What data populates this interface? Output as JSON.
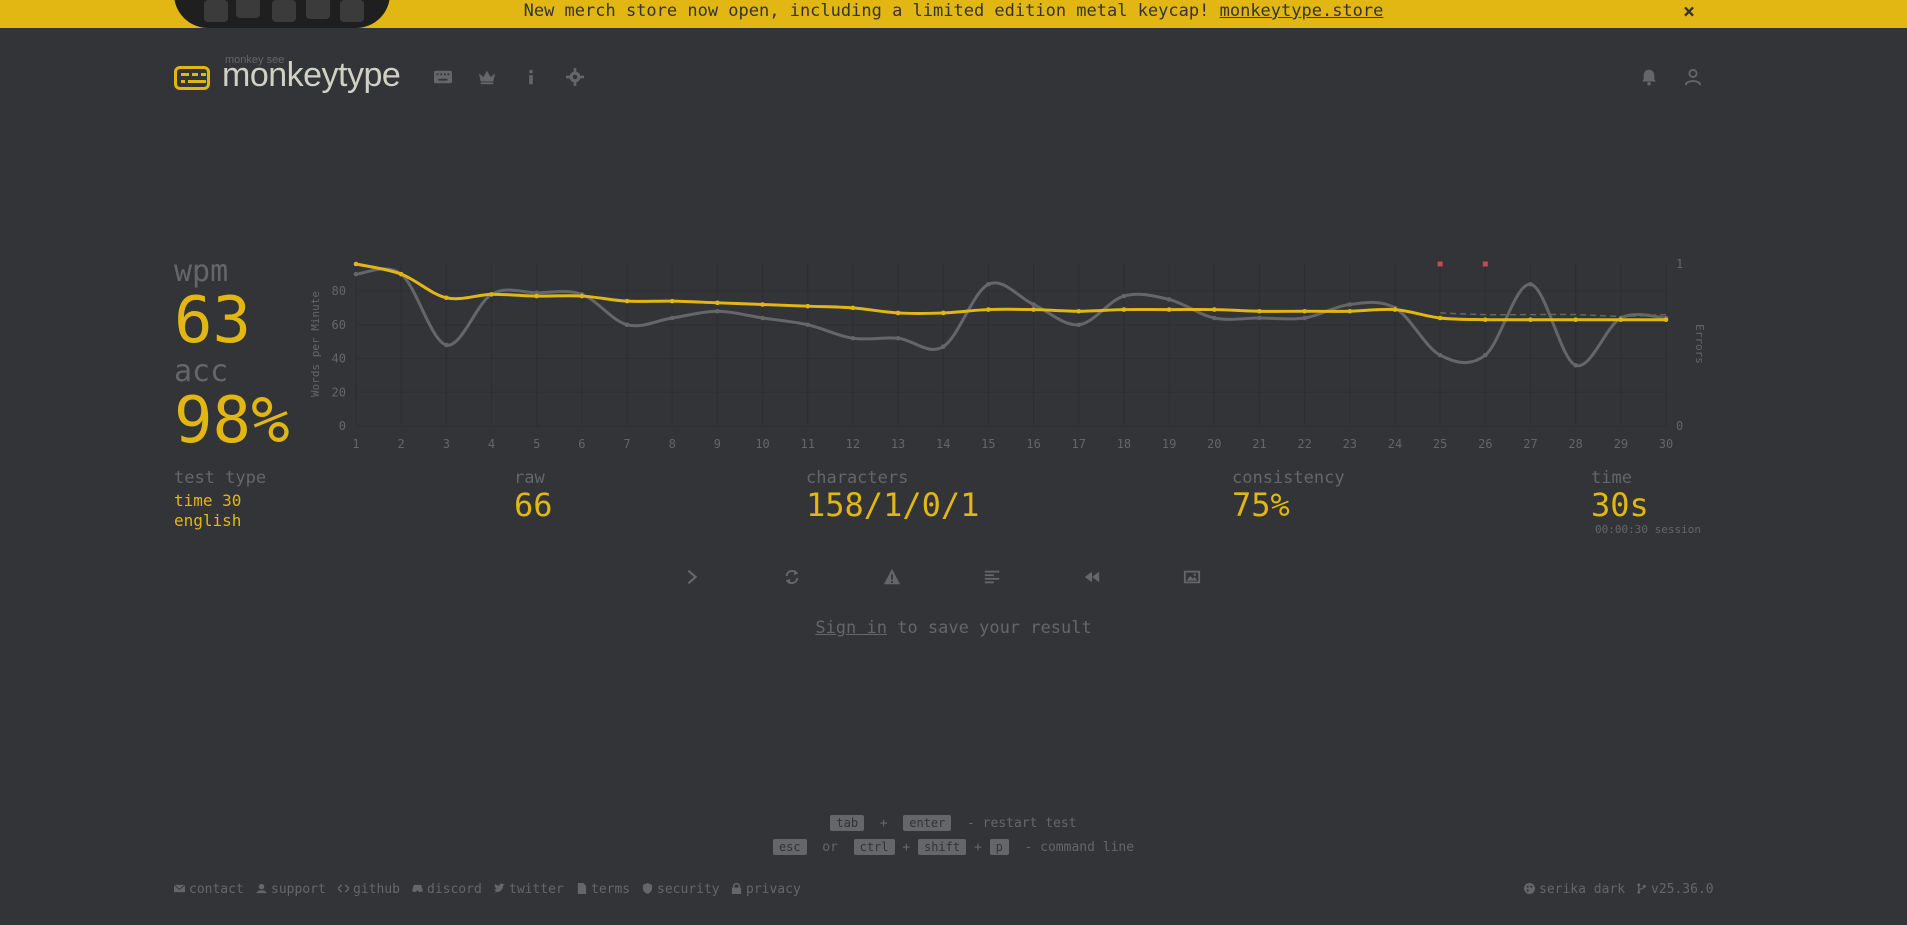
{
  "banner": {
    "text": "New merch store now open, including a limited edition metal keycap!",
    "link": "monkeytype.store",
    "close": "×"
  },
  "header": {
    "logo_top": "monkey see",
    "logo_text": "monkeytype"
  },
  "results": {
    "wpm_label": "wpm",
    "wpm_value": "63",
    "acc_label": "acc",
    "acc_value": "98%",
    "test_type_label": "test type",
    "test_type_mode": "time 30",
    "test_type_language": "english",
    "raw_label": "raw",
    "raw_value": "66",
    "characters_label": "characters",
    "characters_value": "158/1/0/1",
    "consistency_label": "consistency",
    "consistency_value": "75%",
    "time_label": "time",
    "time_value": "30s",
    "session_time": "00:00:30 session"
  },
  "chart_data": {
    "type": "line",
    "ylabel": "Words per Minute",
    "y2label": "Errors",
    "ylim": [
      0,
      96
    ],
    "y2lim": [
      0,
      1
    ],
    "y_ticks": [
      0,
      20,
      40,
      60,
      80
    ],
    "y2_ticks": [
      0,
      1
    ],
    "x": [
      1,
      2,
      3,
      4,
      5,
      6,
      7,
      8,
      9,
      10,
      11,
      12,
      13,
      14,
      15,
      16,
      17,
      18,
      19,
      20,
      21,
      22,
      23,
      24,
      25,
      26,
      27,
      28,
      29,
      30
    ],
    "series": [
      {
        "color": "#e2b714",
        "values": [
          96,
          90,
          76,
          78,
          77,
          77,
          74,
          74,
          73,
          72,
          71,
          70,
          67,
          67,
          69,
          69,
          68,
          69,
          69,
          69,
          68,
          68,
          68,
          69,
          64,
          63,
          63,
          63,
          63,
          63
        ]
      },
      {
        "color": "#646669",
        "values": [
          90,
          90,
          48,
          78,
          79,
          78,
          60,
          64,
          68,
          64,
          60,
          52,
          52,
          47,
          84,
          72,
          60,
          77,
          75,
          64,
          64,
          64,
          72,
          70,
          42,
          42,
          84,
          36,
          64,
          64
        ]
      }
    ],
    "trend": {
      "color": "#646669",
      "values": [
        67,
        66,
        66,
        66,
        65,
        66
      ]
    },
    "errors": [
      {
        "x": 25,
        "value": 1
      },
      {
        "x": 26,
        "value": 1
      }
    ],
    "colors": {
      "grid": "#2c2e31",
      "text": "#646669",
      "error": "#ca4754"
    }
  },
  "actions": [
    {
      "name": "next-test-button",
      "icon": "chevron-right-icon"
    },
    {
      "name": "restart-button",
      "icon": "repeat-icon"
    },
    {
      "name": "practice-words-button",
      "icon": "warning-icon"
    },
    {
      "name": "words-history-button",
      "icon": "align-left-icon"
    },
    {
      "name": "replay-button",
      "icon": "backward-icon"
    },
    {
      "name": "save-screenshot-button",
      "icon": "image-icon"
    }
  ],
  "signin": {
    "link": "Sign in",
    "rest": "to save your result"
  },
  "hints": {
    "tab": "tab",
    "plus": "+",
    "enter": "enter",
    "restart": "- restart test",
    "esc": "esc",
    "or": "or",
    "ctrl": "ctrl",
    "shift": "shift",
    "p": "p",
    "command": "- command line"
  },
  "footer": {
    "contact": "contact",
    "support": "support",
    "github": "github",
    "discord": "discord",
    "twitter": "twitter",
    "terms": "terms",
    "security": "security",
    "privacy": "privacy",
    "theme": "serika dark",
    "version": "v25.36.0"
  }
}
